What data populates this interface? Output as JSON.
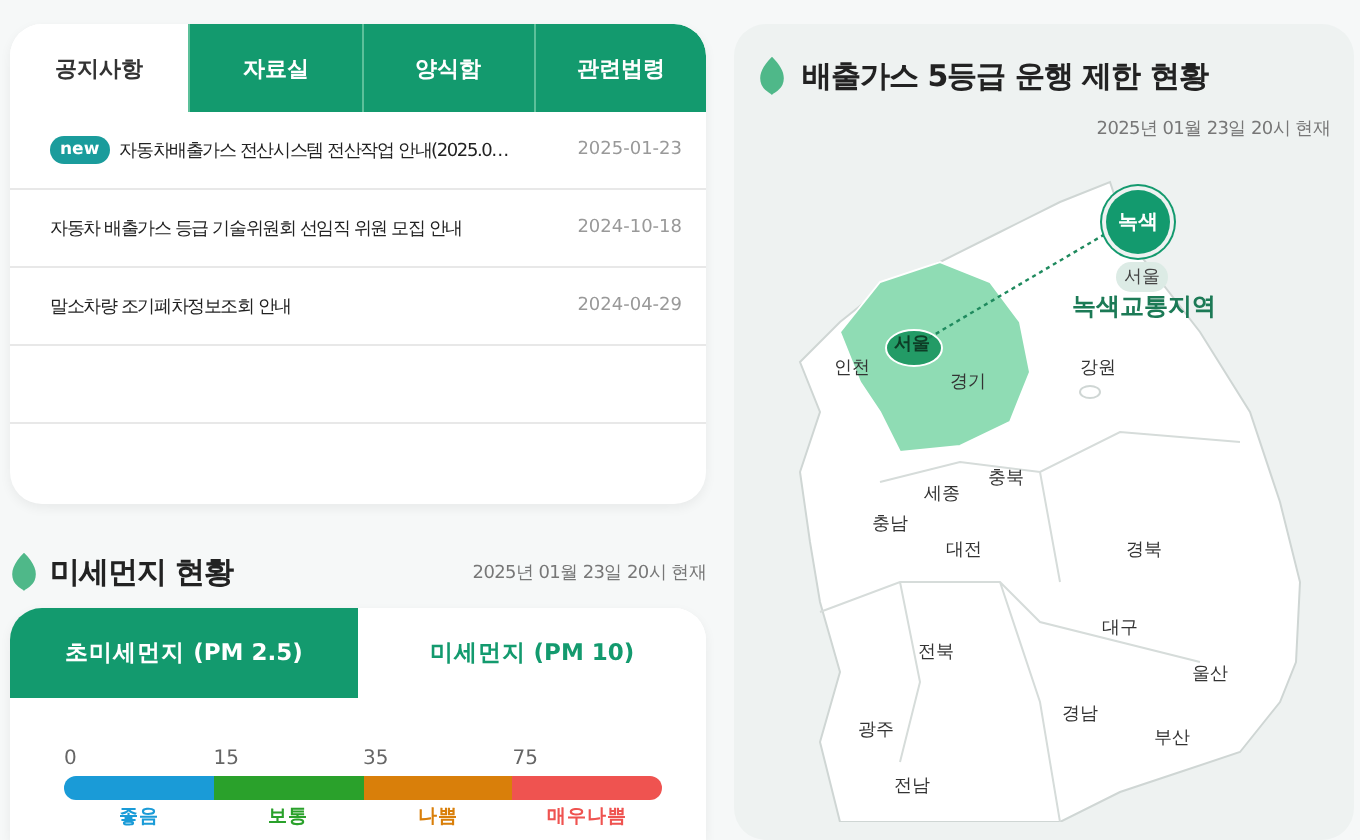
{
  "notice": {
    "tabs": [
      {
        "label": "공지사항",
        "selected": true
      },
      {
        "label": "자료실",
        "selected": false
      },
      {
        "label": "양식함",
        "selected": false
      },
      {
        "label": "관련법령",
        "selected": false
      }
    ],
    "rows": [
      {
        "badge": "new",
        "title": "자동차배출가스 전산시스템 전산작업 안내(2025.0…",
        "date": "2025-01-23"
      },
      {
        "title": "자동차 배출가스 등급 기술위원회 선임직 위원 모집 안내",
        "date": "2024-10-18"
      },
      {
        "title": "말소차량 조기폐차정보조회 안내",
        "date": "2024-04-29"
      }
    ]
  },
  "dust": {
    "title": "미세먼지 현황",
    "timestamp": "2025년 01월 23일 20시 현재",
    "tabs": [
      {
        "label": "초미세먼지 (PM 2.5)",
        "selected": true
      },
      {
        "label": "미세먼지 (PM 10)",
        "selected": false
      }
    ],
    "scale": [
      {
        "tick": "0",
        "label": "좋음",
        "color": "#1a9bd7"
      },
      {
        "tick": "15",
        "label": "보통",
        "color": "#2aa12b"
      },
      {
        "tick": "35",
        "label": "나쁨",
        "color": "#d97f0a"
      },
      {
        "tick": "75",
        "label": "매우나쁨",
        "color": "#ef5350"
      }
    ]
  },
  "restriction": {
    "title": "배출가스 5등급 운행 제한 현황",
    "timestamp": "2025년 01월 23일 20시 현재",
    "callout": {
      "badge": "녹색",
      "city": "서울",
      "zone": "녹색교통지역"
    },
    "regions": [
      "서울",
      "인천",
      "경기",
      "강원",
      "충북",
      "세종",
      "충남",
      "대전",
      "경북",
      "대구",
      "전북",
      "울산",
      "경남",
      "광주",
      "부산",
      "전남"
    ]
  }
}
